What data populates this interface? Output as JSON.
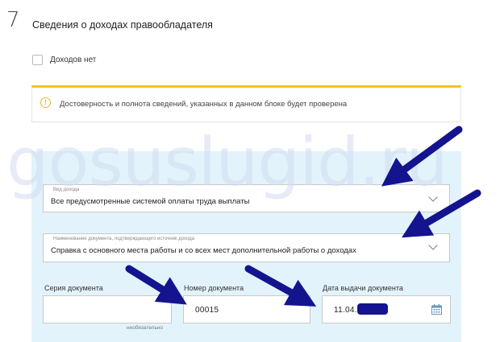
{
  "section": {
    "number": "7",
    "title": "Сведения о доходах правообладателя"
  },
  "no_income": {
    "label": "Доходов нет",
    "checked": false
  },
  "notice": {
    "icon": "warning-circle-icon",
    "text": "Достоверность и полнота сведений, указанных в данном блоке будет проверена",
    "accent_color": "#f3c417"
  },
  "income_type": {
    "label": "Вид дохода",
    "value": "Все предусмотренные системой оплаты труда выплаты"
  },
  "document_name": {
    "label": "Наименование документа, подтверждающего источник дохода",
    "value": "Справка с основного места работы и со всех мест дополнительной работы о доходах"
  },
  "series": {
    "label": "Серия документа",
    "value": "",
    "hint": "необязательно"
  },
  "doc_number": {
    "label": "Номер документа",
    "value": "00015"
  },
  "issue_date": {
    "label": "Дата выдачи документа",
    "value": "11.04.",
    "icon": "calendar-icon"
  },
  "watermark": "gosuslugid.ru",
  "colors": {
    "panel_bg": "#e3f3fb",
    "arrow": "#14148f",
    "accent": "#f3c417"
  }
}
